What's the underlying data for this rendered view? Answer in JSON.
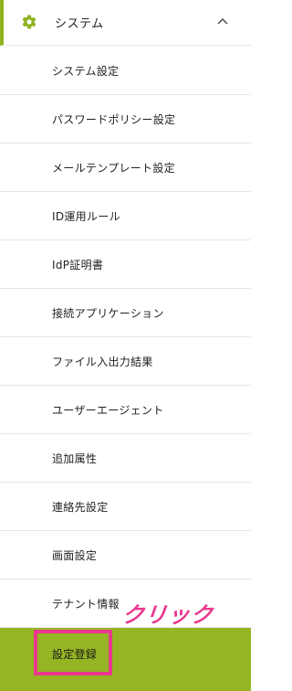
{
  "section": {
    "label": "システム",
    "icon": "gear-icon",
    "expanded_icon": "chevron-up-icon",
    "accent_color": "#8fb21e"
  },
  "menu_items": [
    {
      "label": "システム設定"
    },
    {
      "label": "パスワードポリシー設定"
    },
    {
      "label": "メールテンプレート設定"
    },
    {
      "label": "ID運用ルール"
    },
    {
      "label": "IdP証明書"
    },
    {
      "label": "接続アプリケーション"
    },
    {
      "label": "ファイル入出力結果"
    },
    {
      "label": "ユーザーエージェント"
    },
    {
      "label": "追加属性"
    },
    {
      "label": "連絡先設定"
    },
    {
      "label": "画面設定"
    },
    {
      "label": "テナント情報"
    },
    {
      "label": "設定登録"
    }
  ],
  "active_item_color": "#95b524",
  "annotation": {
    "text": "クリック",
    "color": "#e8398d"
  }
}
